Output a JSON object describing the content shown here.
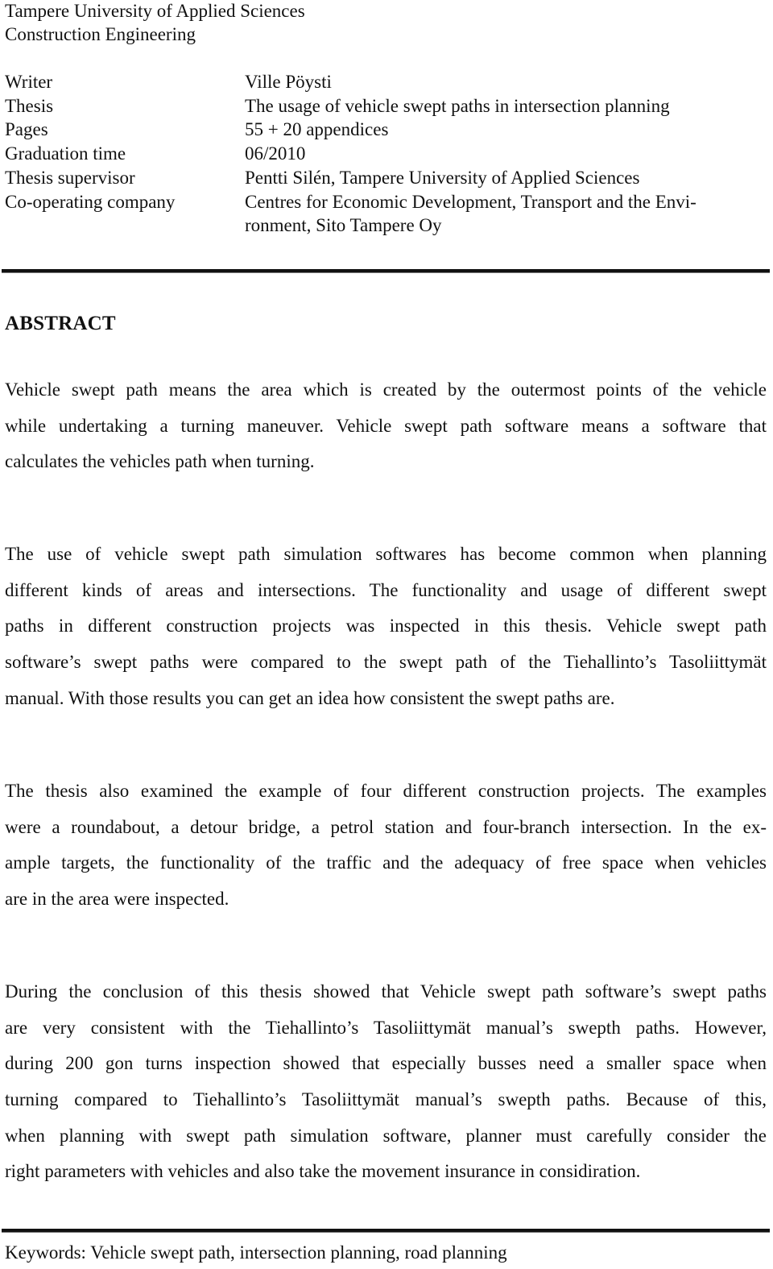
{
  "header": {
    "institution": "Tampere University of Applied Sciences",
    "degree_programme": "Construction Engineering"
  },
  "meta": [
    {
      "label": "Writer",
      "value": [
        "Ville Pöysti"
      ]
    },
    {
      "label": "Thesis",
      "value": [
        "The usage of vehicle swept paths in intersection planning"
      ]
    },
    {
      "label": "Pages",
      "value": [
        "55 + 20 appendices"
      ]
    },
    {
      "label": "Graduation time",
      "value": [
        "06/2010"
      ]
    },
    {
      "label": "Thesis supervisor",
      "value": [
        "Pentti Silén, Tampere University of Applied Sciences"
      ]
    },
    {
      "label": "Co-operating company",
      "value": [
        "Centres for Economic Development, Transport and the Envi-",
        "ronment, Sito Tampere Oy"
      ]
    }
  ],
  "abstract": {
    "heading": "ABSTRACT",
    "paragraphs": [
      {
        "lines": [
          "Vehicle swept path means the area which is created by the outermost points of the vehicle",
          "while undertaking a turning maneuver. Vehicle swept path software means a software that",
          "calculates the vehicles path when turning."
        ]
      },
      {
        "lines": [
          "The use of vehicle swept path simulation softwares has become common when planning",
          "different kinds of areas and intersections. The functionality and usage of different swept",
          "paths in different construction projects was inspected in this thesis. Vehicle swept path",
          "software’s swept paths were compared to the swept path of the Tiehallinto’s Tasoliittymät",
          "manual. With those results you can get an idea how consistent the swept paths are."
        ]
      },
      {
        "lines": [
          "The thesis also examined the example of four different construction projects. The examples",
          "were a roundabout, a detour bridge, a petrol station and four-branch intersection. In the ex-",
          "ample targets, the functionality of the traffic and the adequacy of free space when vehicles",
          "are in the area were inspected."
        ]
      },
      {
        "lines": [
          "During the conclusion of this thesis showed that Vehicle swept path software’s swept paths",
          "are very consistent with the Tiehallinto’s Tasoliittymät manual’s swepth paths. However,",
          "during 200 gon turns inspection showed that especially busses need a smaller space when",
          "turning compared to Tiehallinto’s Tasoliittymät manual’s swepth paths. Because of this,",
          "when planning with swept path simulation software, planner must carefully consider the",
          "right parameters with vehicles and also take the movement insurance in considiration."
        ]
      }
    ]
  },
  "keywords": "Keywords: Vehicle swept path, intersection planning, road planning"
}
